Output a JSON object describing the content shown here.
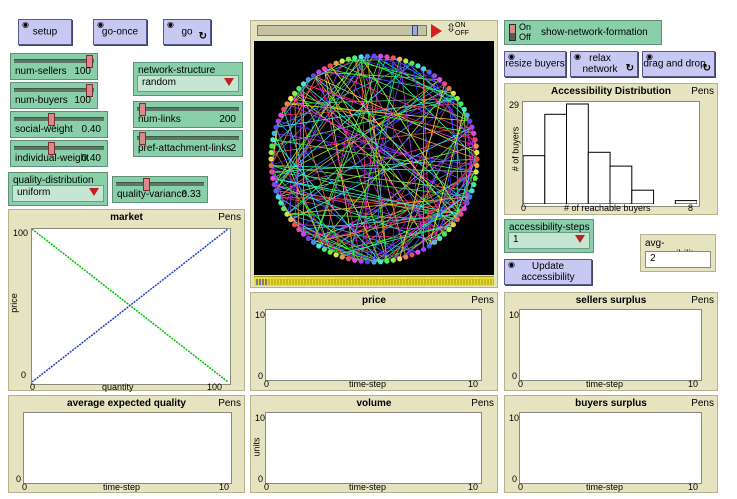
{
  "buttons": {
    "setup": "setup",
    "go_once": "go-once",
    "go": "go",
    "resize_buyers": "resize buyers",
    "relax_network": "relax network",
    "drag_and_drop": "drag and drop",
    "update_accessibility": "Update accessibility"
  },
  "sliders": [
    {
      "name": "num-sellers",
      "value": "100",
      "fraction": 0.97
    },
    {
      "name": "num-buyers",
      "value": "100",
      "fraction": 0.97
    },
    {
      "name": "social-weight",
      "value": "0.40",
      "fraction": 0.4
    },
    {
      "name": "individual-weight",
      "value": "0.40",
      "fraction": 0.4
    },
    {
      "name": "num-links",
      "value": "200",
      "fraction": 0.02
    },
    {
      "name": "pref-attachment-links",
      "value": "2",
      "fraction": 0.02
    },
    {
      "name": "quality-variance",
      "value": "0.33",
      "fraction": 0.33
    }
  ],
  "choosers": {
    "network_structure": {
      "name": "network-structure",
      "value": "random"
    },
    "quality_distribution": {
      "name": "quality-distribution",
      "value": "uniform"
    },
    "accessibility_steps": {
      "name": "accessibility-steps",
      "value": "1"
    }
  },
  "switch": {
    "label": "show-network-formation",
    "on": "On",
    "off": "Off",
    "state": "on"
  },
  "monitor": {
    "name": "avg-accessibility",
    "value": "2"
  },
  "view": {
    "speed": 0.95,
    "on_label": "ON",
    "off_label": "OFF"
  },
  "colors": {
    "button": "#c7c9f2",
    "slider": "#89cfa9",
    "plot": "#e6e3c1",
    "view_bg": "#000000"
  },
  "plots": {
    "market": {
      "title": "market",
      "pens": "Pens",
      "xlabel": "quantity",
      "ylabel": "price",
      "xmin": "0",
      "xmax": "100",
      "ymin": "0",
      "ymax": "100"
    },
    "accessibility": {
      "title": "Accessibility Distribution",
      "pens": "Pens",
      "xlabel": "# of reachable buyers",
      "ylabel": "# of buyers",
      "xmin": "0",
      "xmax": "8",
      "ymax": "29"
    },
    "price": {
      "title": "price",
      "pens": "Pens",
      "xlabel": "time-step",
      "xmin": "0",
      "xmax": "10",
      "ymin": "0",
      "ymax": "10"
    },
    "sellers_surplus": {
      "title": "sellers surplus",
      "pens": "Pens",
      "xlabel": "time-step",
      "xmin": "0",
      "xmax": "10",
      "ymin": "0",
      "ymax": "10"
    },
    "avg_quality": {
      "title": "average expected quality",
      "pens": "Pens",
      "xlabel": "time-step",
      "xmin": "0",
      "xmax": "10",
      "ymin": "0"
    },
    "volume": {
      "title": "volume",
      "pens": "Pens",
      "xlabel": "time-step",
      "ylabel": "units",
      "xmin": "0",
      "xmax": "10",
      "ymin": "0",
      "ymax": "10"
    },
    "buyers_surplus": {
      "title": "buyers surplus",
      "pens": "Pens",
      "xlabel": "time-step",
      "xmin": "0",
      "xmax": "10",
      "ymin": "0",
      "ymax": "10"
    }
  },
  "chart_data": [
    {
      "type": "line",
      "title": "market",
      "xlabel": "quantity",
      "ylabel": "price",
      "xlim": [
        0,
        100
      ],
      "ylim": [
        0,
        100
      ],
      "series": [
        {
          "color": "#00c000",
          "x": [
            0,
            100
          ],
          "values": [
            100,
            0
          ]
        },
        {
          "color": "#2040c0",
          "x": [
            0,
            100
          ],
          "values": [
            0,
            100
          ]
        }
      ]
    },
    {
      "type": "bar",
      "title": "Accessibility Distribution",
      "xlabel": "# of reachable buyers",
      "ylabel": "# of buyers",
      "xlim": [
        0,
        8
      ],
      "ylim": [
        0,
        29
      ],
      "categories": [
        "0",
        "1",
        "2",
        "3",
        "4",
        "5",
        "6",
        "7"
      ],
      "values": [
        14,
        26,
        29,
        15,
        11,
        4,
        0,
        1
      ]
    }
  ]
}
